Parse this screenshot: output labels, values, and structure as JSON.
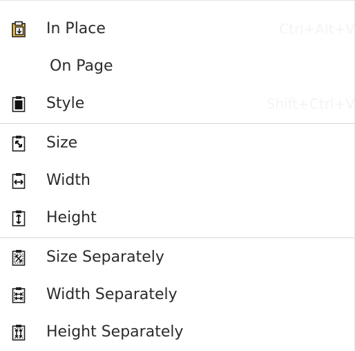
{
  "menu": {
    "items": [
      {
        "label": "In Place",
        "shortcut": "Ctrl+Alt+V",
        "icon": "paste-in-place-icon"
      },
      {
        "label": "On Page",
        "shortcut": "",
        "icon": ""
      },
      {
        "label": "Style",
        "shortcut": "Shift+Ctrl+V",
        "icon": "paste-style-icon"
      },
      {
        "label": "Size",
        "shortcut": "",
        "icon": "paste-size-icon"
      },
      {
        "label": "Width",
        "shortcut": "",
        "icon": "paste-width-icon"
      },
      {
        "label": "Height",
        "shortcut": "",
        "icon": "paste-height-icon"
      },
      {
        "label": "Size Separately",
        "shortcut": "",
        "icon": "paste-size-separately-icon"
      },
      {
        "label": "Width Separately",
        "shortcut": "",
        "icon": "paste-width-separately-icon"
      },
      {
        "label": "Height Separately",
        "shortcut": "",
        "icon": "paste-height-separately-icon"
      }
    ]
  }
}
